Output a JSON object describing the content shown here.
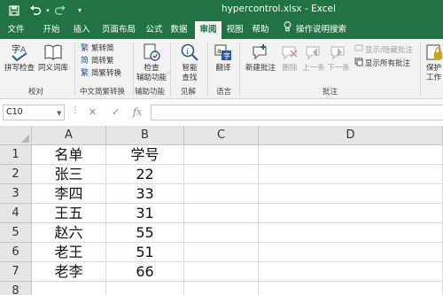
{
  "title_bar": {
    "title": "hypercontrol.xlsx  -  Excel",
    "icons": [
      "save-icon",
      "undo-icon",
      "undo-dropdown-icon",
      "redo-icon",
      "customize-qat-icon"
    ]
  },
  "menu": {
    "tabs": [
      "文件",
      "开始",
      "插入",
      "页面布局",
      "公式",
      "数据",
      "审阅",
      "视图",
      "帮助"
    ],
    "active_tab": "审阅",
    "tell_me": "操作说明搜索"
  },
  "ribbon": {
    "proofing": {
      "spell_check": "拼写检查",
      "thesaurus": "同义词库",
      "group_label": "校对"
    },
    "chinese_conversion": {
      "to_simplified": "繁转简",
      "to_traditional": "简转繁",
      "convert": "简繁转换",
      "group_label": "中文简繁转换"
    },
    "accessibility": {
      "check": [
        "检查",
        "辅助功能"
      ],
      "group_label": "辅助功能"
    },
    "insights": {
      "smart_lookup": [
        "智能",
        "查找"
      ],
      "group_label": "见解"
    },
    "language": {
      "translate": "翻译",
      "group_label": "语言"
    },
    "comments": {
      "new_comment": "新建批注",
      "delete": "删除",
      "previous": "上一条",
      "next": "下一条",
      "show_hide": "显示/隐藏批注",
      "show_all": "显示所有批注",
      "group_label": "批注"
    },
    "protect": {
      "label_line1": "保护",
      "label_line2": "工作"
    }
  },
  "formula_bar": {
    "name_box": "C10",
    "cancel": "✕",
    "enter": "✓",
    "fx": "fx",
    "formula": ""
  },
  "sheet": {
    "columns": [
      "A",
      "B",
      "C",
      "D"
    ],
    "row_numbers": [
      "1",
      "2",
      "3",
      "4",
      "5",
      "6",
      "7",
      "8"
    ],
    "rows": [
      [
        "名单",
        "学号",
        "",
        ""
      ],
      [
        "张三",
        "22",
        "",
        ""
      ],
      [
        "李四",
        "33",
        "",
        ""
      ],
      [
        "王五",
        "31",
        "",
        ""
      ],
      [
        "赵六",
        "55",
        "",
        ""
      ],
      [
        "老王",
        "51",
        "",
        ""
      ],
      [
        "老李",
        "66",
        "",
        ""
      ],
      [
        "",
        "",
        "",
        ""
      ]
    ]
  },
  "colors": {
    "excel_green": "#217346",
    "ribbon_bg": "#f3f3f3",
    "header_bg": "#e6e6e6"
  }
}
